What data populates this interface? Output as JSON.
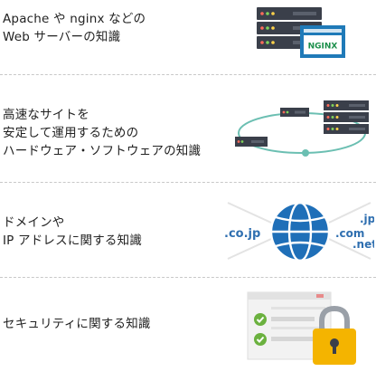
{
  "items": [
    {
      "lines": [
        "Apache や nginx などの",
        "Web サーバーの知識"
      ],
      "icon": "servers-nginx-icon",
      "badge": "NGINX"
    },
    {
      "lines": [
        "高速なサイトを",
        "安定して運用するための",
        "ハードウェア・ソフトウェアの知識"
      ],
      "icon": "server-network-icon"
    },
    {
      "lines": [
        "ドメインや",
        "IP アドレスに関する知識"
      ],
      "icon": "globe-domain-icon",
      "domains": {
        "left": ".co.jp",
        "top_right": ".jp",
        "mid_right": ".com",
        "bottom_right": ".net"
      }
    },
    {
      "lines": [
        "セキュリティに関する知識"
      ],
      "icon": "checklist-lock-icon"
    }
  ],
  "colors": {
    "server_dark": "#3a3f4a",
    "server_light": "#5a606c",
    "nginx_green": "#1a8f4a",
    "window_blue": "#1f7ab8",
    "teal": "#6bbfb2",
    "globe_blue": "#1f6fb8",
    "domain_blue": "#2f6fb0",
    "check_green": "#6bb13f",
    "lock_yellow": "#f4b400",
    "lock_shackle": "#9aa0a8"
  }
}
